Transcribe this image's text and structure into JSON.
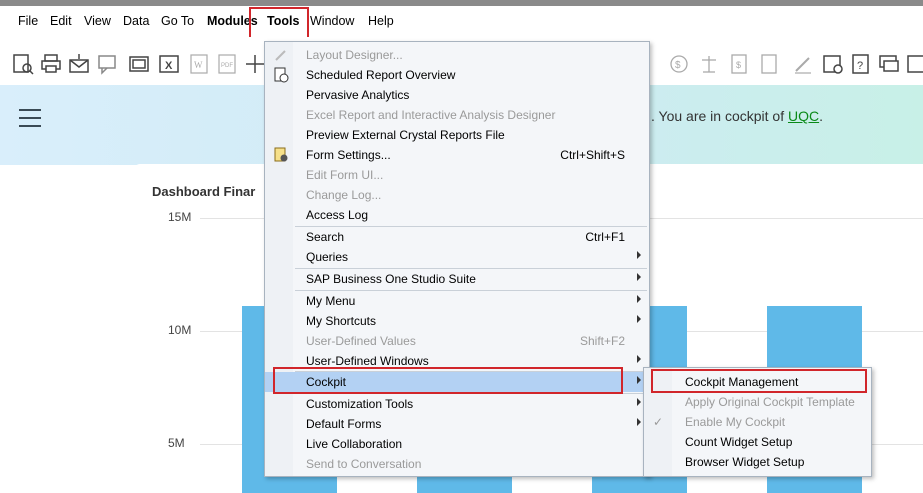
{
  "menubar": {
    "items": [
      {
        "label": "File"
      },
      {
        "label": "Edit"
      },
      {
        "label": "View"
      },
      {
        "label": "Data"
      },
      {
        "label": "Go To"
      },
      {
        "label": "Modules"
      },
      {
        "label": "Tools"
      },
      {
        "label": "Window"
      },
      {
        "label": "Help"
      }
    ]
  },
  "banner": {
    "message": ". You are in cockpit of ",
    "cockpit_name": "UQC",
    "message_end": "."
  },
  "dashboard": {
    "title": "Dashboard Finar",
    "chart_data": {
      "type": "bar",
      "title": "Dashboard Finar",
      "yticks": [
        "15M",
        "10M",
        "5M"
      ],
      "values_visible": [
        11100000,
        4600000,
        11100000,
        11100000
      ],
      "ylim": [
        0,
        15000000
      ],
      "grid": true
    }
  },
  "tools_menu": {
    "items": [
      {
        "label": "Layout Designer...",
        "disabled": true
      },
      {
        "label": "Scheduled Report Overview"
      },
      {
        "label": "Pervasive Analytics"
      },
      {
        "label": "Excel Report and Interactive Analysis Designer",
        "disabled": true
      },
      {
        "label": "Preview External Crystal Reports File"
      },
      {
        "label": "Form Settings...",
        "shortcut": "Ctrl+Shift+S"
      },
      {
        "label": "Edit Form UI...",
        "disabled": true
      },
      {
        "label": "Change Log...",
        "disabled": true
      },
      {
        "label": "Access Log"
      },
      {
        "label": "Search",
        "shortcut": "Ctrl+F1"
      },
      {
        "label": "Queries"
      },
      {
        "label": "SAP Business One Studio Suite"
      },
      {
        "label": "My Menu"
      },
      {
        "label": "My Shortcuts"
      },
      {
        "label": "User-Defined Values",
        "shortcut": "Shift+F2",
        "disabled": true
      },
      {
        "label": "User-Defined Windows"
      },
      {
        "label": "Cockpit"
      },
      {
        "label": "Customization Tools"
      },
      {
        "label": "Default Forms"
      },
      {
        "label": "Live Collaboration"
      },
      {
        "label": "Send to Conversation",
        "disabled": true
      }
    ]
  },
  "cockpit_submenu": {
    "items": [
      {
        "label": "Cockpit Management"
      },
      {
        "label": "Apply Original Cockpit Template",
        "disabled": true
      },
      {
        "label": "Enable My Cockpit",
        "disabled": true,
        "checked": true
      },
      {
        "label": "Count Widget Setup"
      },
      {
        "label": "Browser Widget Setup"
      }
    ]
  },
  "colors": {
    "accent_red": "#d1262b",
    "highlight": "#b3d1f3",
    "bar": "#5fb9e8",
    "link": "#0a8a18"
  }
}
